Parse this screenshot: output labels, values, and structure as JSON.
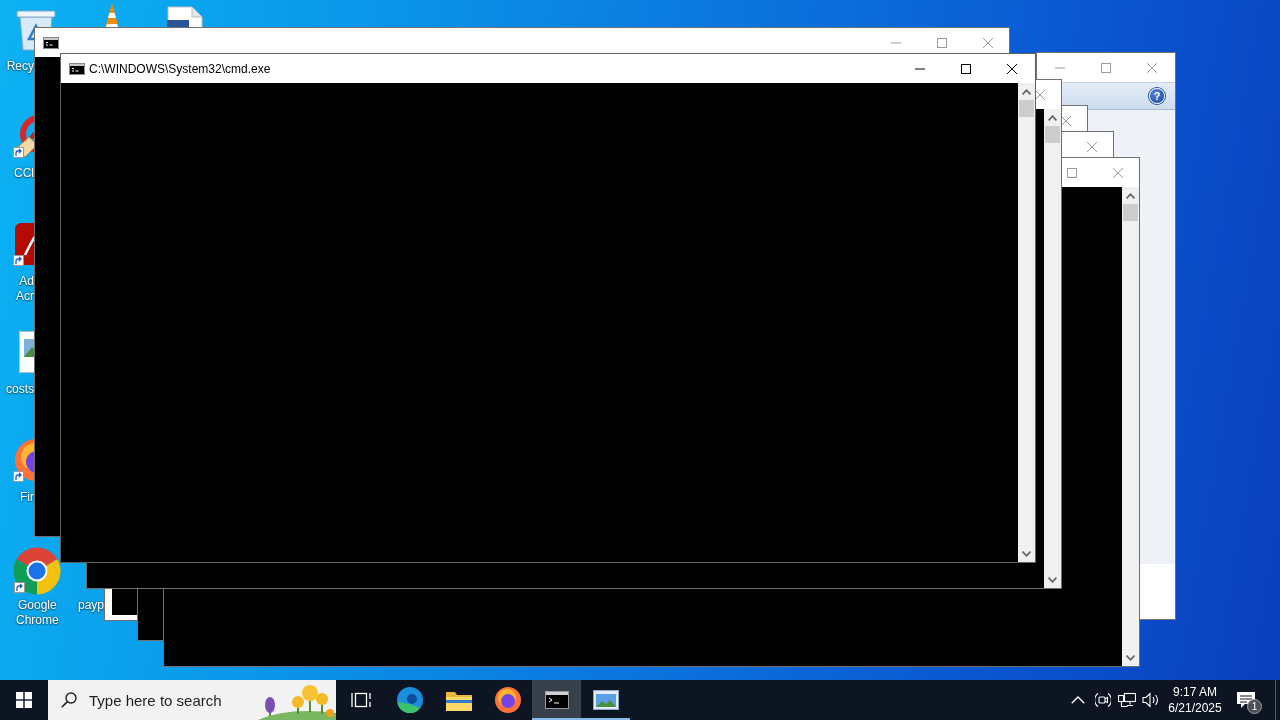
{
  "desktop": {
    "icons": [
      {
        "kind": "bin",
        "label": "Recy",
        "shortcut": false
      },
      {
        "kind": "cone"
      },
      {
        "kind": "document"
      },
      {
        "kind": "cleaner",
        "label": "CCl",
        "shortcut": true
      },
      {
        "kind": "reader",
        "label": "Ad Acr",
        "shortcut": true
      },
      {
        "kind": "image",
        "label": "costs",
        "shortcut": false
      },
      {
        "kind": "firefox",
        "label": "Fir",
        "shortcut": true
      },
      {
        "kind": "chrome",
        "label": "Google Chrome",
        "shortcut": true
      },
      {
        "kind": "label",
        "label": "payp"
      }
    ]
  },
  "windows": [
    {
      "kind": "console",
      "active": false,
      "icon": true,
      "controls": [
        {
          "kind": "minimize"
        },
        {
          "kind": "maximize"
        },
        {
          "kind": "close"
        }
      ]
    },
    {
      "kind": "dialog",
      "active": false,
      "help": "?",
      "controls": [
        {
          "kind": "minimize"
        },
        {
          "kind": "maximize"
        },
        {
          "kind": "close"
        }
      ]
    },
    {
      "kind": "console",
      "active": false,
      "controls": [
        {
          "kind": "close"
        }
      ]
    },
    {
      "kind": "console",
      "active": false,
      "controls": [
        {
          "kind": "close"
        }
      ]
    },
    {
      "kind": "console",
      "active": false,
      "scrollbar": true,
      "controls": [
        {
          "kind": "maximize"
        },
        {
          "kind": "close"
        }
      ]
    },
    {
      "kind": "console",
      "active": false,
      "scrollbar": true,
      "controls": [
        {
          "kind": "close"
        }
      ]
    },
    {
      "kind": "console",
      "active": true,
      "icon": true,
      "title": "C:\\WINDOWS\\System32\\cmd.exe",
      "scrollbar": true,
      "controls": [
        {
          "kind": "minimize"
        },
        {
          "kind": "maximize"
        },
        {
          "kind": "close"
        }
      ]
    }
  ],
  "taskbar": {
    "search": {
      "placeholder": "Type here to search"
    },
    "apps": [
      {
        "kind": "taskview",
        "selected": false,
        "running": false
      },
      {
        "kind": "edge",
        "selected": false,
        "running": false
      },
      {
        "kind": "explorer",
        "selected": false,
        "running": false
      },
      {
        "kind": "firefox",
        "selected": false,
        "running": false
      },
      {
        "kind": "console",
        "selected": true,
        "running": true
      },
      {
        "kind": "picture",
        "selected": false,
        "running": true
      }
    ],
    "tray": [
      {
        "kind": "chevron"
      },
      {
        "kind": "camera"
      },
      {
        "kind": "network"
      },
      {
        "kind": "volume"
      }
    ],
    "clock": {
      "time": "9:17 AM",
      "date": "6/21/2025"
    },
    "notifications": {
      "count": "1"
    }
  }
}
